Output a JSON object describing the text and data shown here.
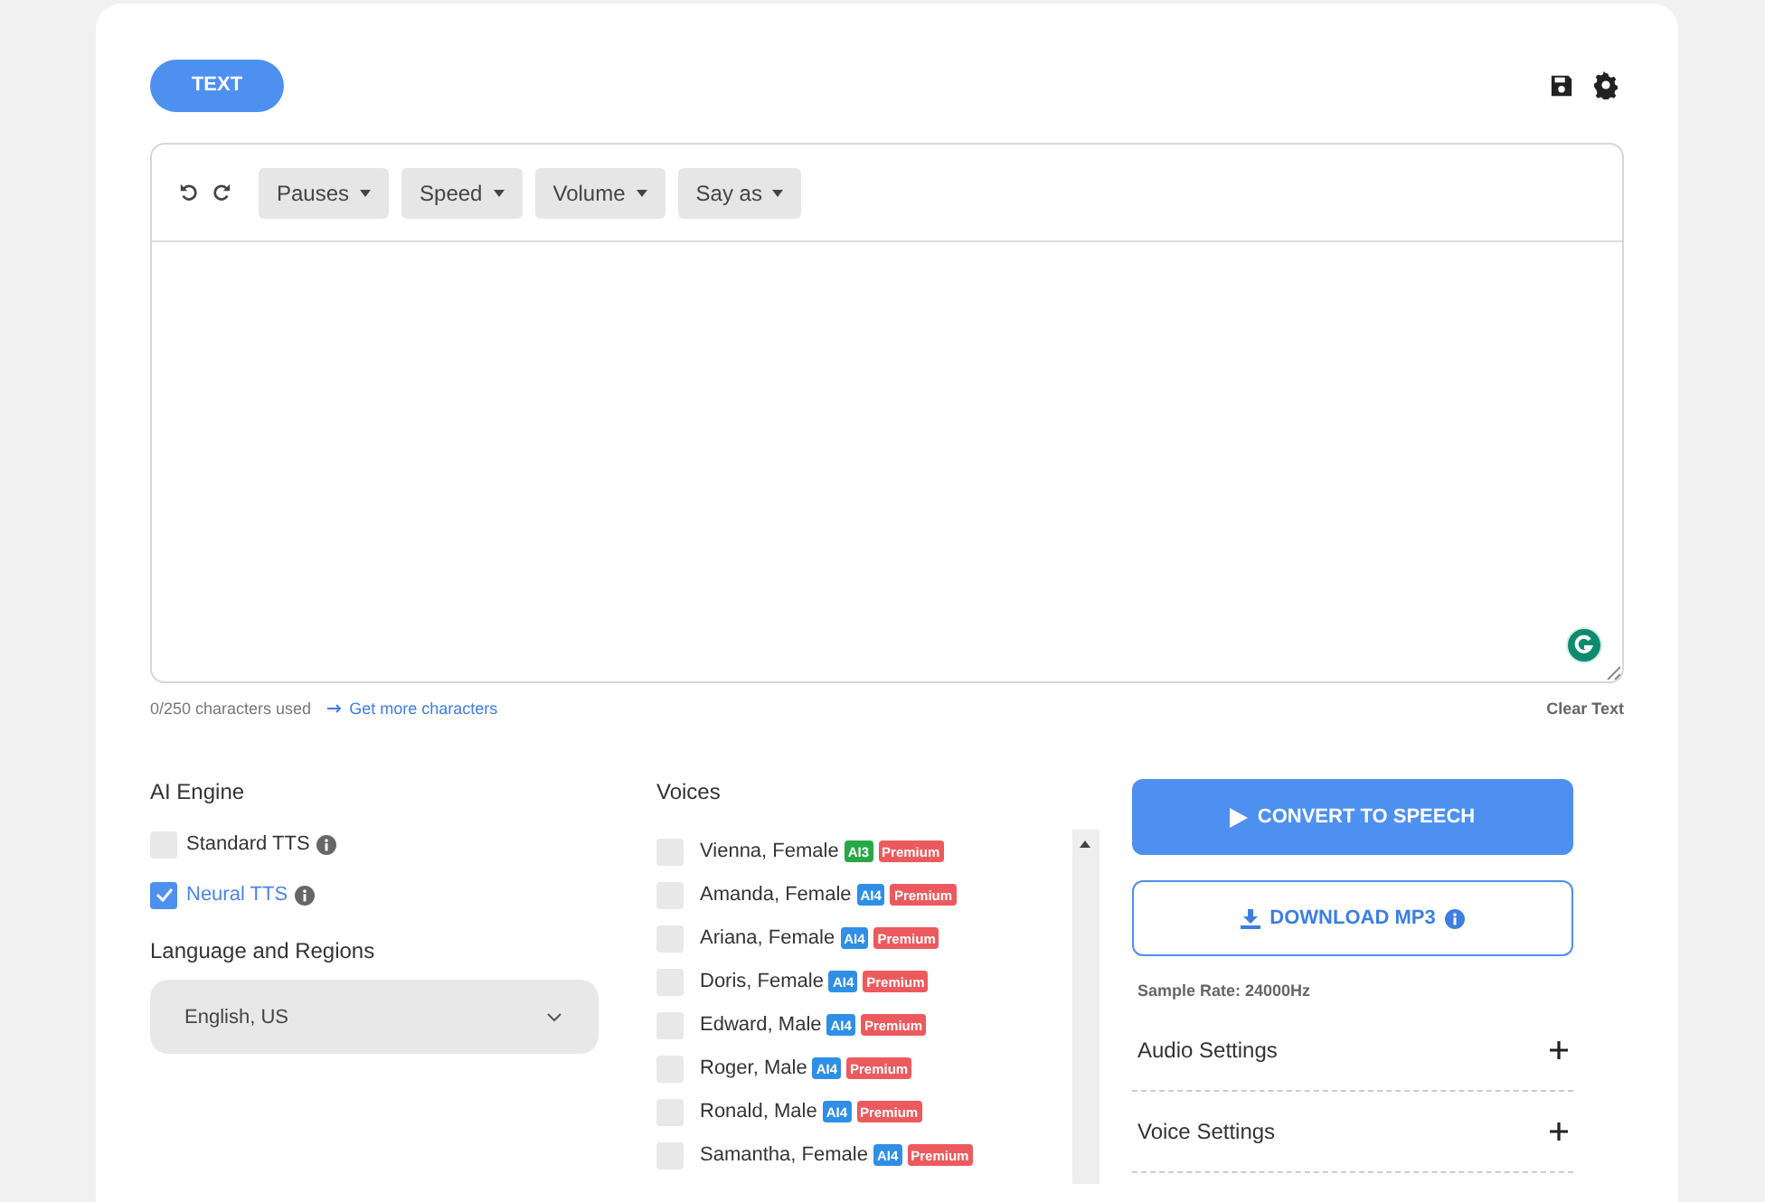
{
  "header": {
    "mode_button": "TEXT"
  },
  "toolbar": {
    "menus": [
      "Pauses",
      "Speed",
      "Volume",
      "Say as"
    ]
  },
  "editor": {
    "counter": "0/250 characters used",
    "more_link": "Get more characters",
    "clear": "Clear Text"
  },
  "engine": {
    "title": "AI Engine",
    "options": [
      {
        "label": "Standard TTS",
        "checked": false
      },
      {
        "label": "Neural TTS",
        "checked": true
      }
    ]
  },
  "language": {
    "title": "Language and Regions",
    "value": "English, US"
  },
  "voices": {
    "title": "Voices",
    "items": [
      {
        "name": "Vienna, Female",
        "model": "AI3",
        "color": "#28a745",
        "tier": "Premium",
        "checked": false
      },
      {
        "name": "Amanda, Female",
        "model": "AI4",
        "color": "#2f8fe6",
        "tier": "Premium",
        "checked": false
      },
      {
        "name": "Ariana, Female",
        "model": "AI4",
        "color": "#2f8fe6",
        "tier": "Premium",
        "checked": false
      },
      {
        "name": "Doris, Female",
        "model": "AI4",
        "color": "#2f8fe6",
        "tier": "Premium",
        "checked": false
      },
      {
        "name": "Edward, Male",
        "model": "AI4",
        "color": "#2f8fe6",
        "tier": "Premium",
        "checked": false
      },
      {
        "name": "Roger, Male",
        "model": "AI4",
        "color": "#2f8fe6",
        "tier": "Premium",
        "checked": false
      },
      {
        "name": "Ronald, Male",
        "model": "AI4",
        "color": "#2f8fe6",
        "tier": "Premium",
        "checked": false
      },
      {
        "name": "Samantha, Female",
        "model": "AI4",
        "color": "#2f8fe6",
        "tier": "Premium",
        "checked": false
      }
    ]
  },
  "actions": {
    "convert": "CONVERT TO SPEECH",
    "download": "DOWNLOAD MP3",
    "sample_rate": "Sample Rate: 24000Hz"
  },
  "settings": [
    {
      "label": "Audio Settings"
    },
    {
      "label": "Voice Settings"
    }
  ]
}
